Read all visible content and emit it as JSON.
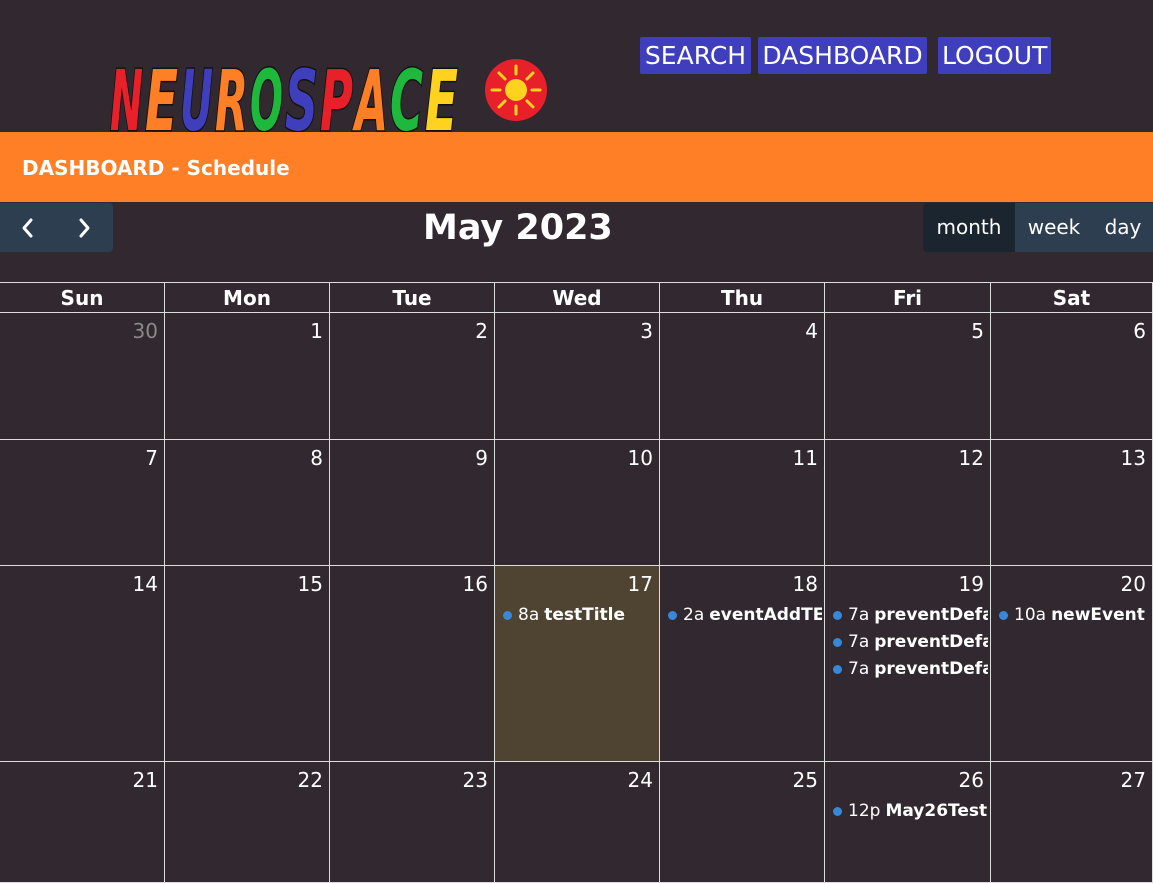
{
  "app": {
    "logo_text": "NEUROSPACE",
    "nav": [
      {
        "label": "SEARCH"
      },
      {
        "label": "DASHBOARD"
      },
      {
        "label": "LOGOUT"
      }
    ]
  },
  "banner": {
    "title": "DASHBOARD - Schedule"
  },
  "calendar": {
    "title": "May 2023",
    "prev_icon": "chevron-left-icon",
    "next_icon": "chevron-right-icon",
    "views": [
      {
        "label": "month",
        "active": true
      },
      {
        "label": "week",
        "active": false
      },
      {
        "label": "day",
        "active": false
      }
    ],
    "weekdays": [
      "Sun",
      "Mon",
      "Tue",
      "Wed",
      "Thu",
      "Fri",
      "Sat"
    ],
    "weeks": [
      [
        {
          "day": "30",
          "other_month": true
        },
        {
          "day": "1"
        },
        {
          "day": "2"
        },
        {
          "day": "3"
        },
        {
          "day": "4"
        },
        {
          "day": "5"
        },
        {
          "day": "6"
        }
      ],
      [
        {
          "day": "7"
        },
        {
          "day": "8"
        },
        {
          "day": "9"
        },
        {
          "day": "10"
        },
        {
          "day": "11"
        },
        {
          "day": "12"
        },
        {
          "day": "13"
        }
      ],
      [
        {
          "day": "14"
        },
        {
          "day": "15"
        },
        {
          "day": "16"
        },
        {
          "day": "17",
          "today": true,
          "events": [
            {
              "time": "8a",
              "title": "testTitle"
            }
          ]
        },
        {
          "day": "18",
          "events": [
            {
              "time": "2a",
              "title": "eventAddTE"
            }
          ]
        },
        {
          "day": "19",
          "events": [
            {
              "time": "7a",
              "title": "preventDefa"
            },
            {
              "time": "7a",
              "title": "preventDefa"
            },
            {
              "time": "7a",
              "title": "preventDefa"
            }
          ]
        },
        {
          "day": "20",
          "events": [
            {
              "time": "10a",
              "title": "newEvent C"
            }
          ]
        }
      ],
      [
        {
          "day": "21"
        },
        {
          "day": "22"
        },
        {
          "day": "23"
        },
        {
          "day": "24"
        },
        {
          "day": "25"
        },
        {
          "day": "26",
          "events": [
            {
              "time": "12p",
              "title": "May26Test"
            }
          ]
        },
        {
          "day": "27"
        }
      ]
    ]
  },
  "colors": {
    "background": "#322830",
    "banner": "#ff7f27",
    "nav_button": "#3f3fbe",
    "toolbar": "#2c3e50",
    "today": "#4f4331",
    "event_dot": "#3788d8"
  }
}
